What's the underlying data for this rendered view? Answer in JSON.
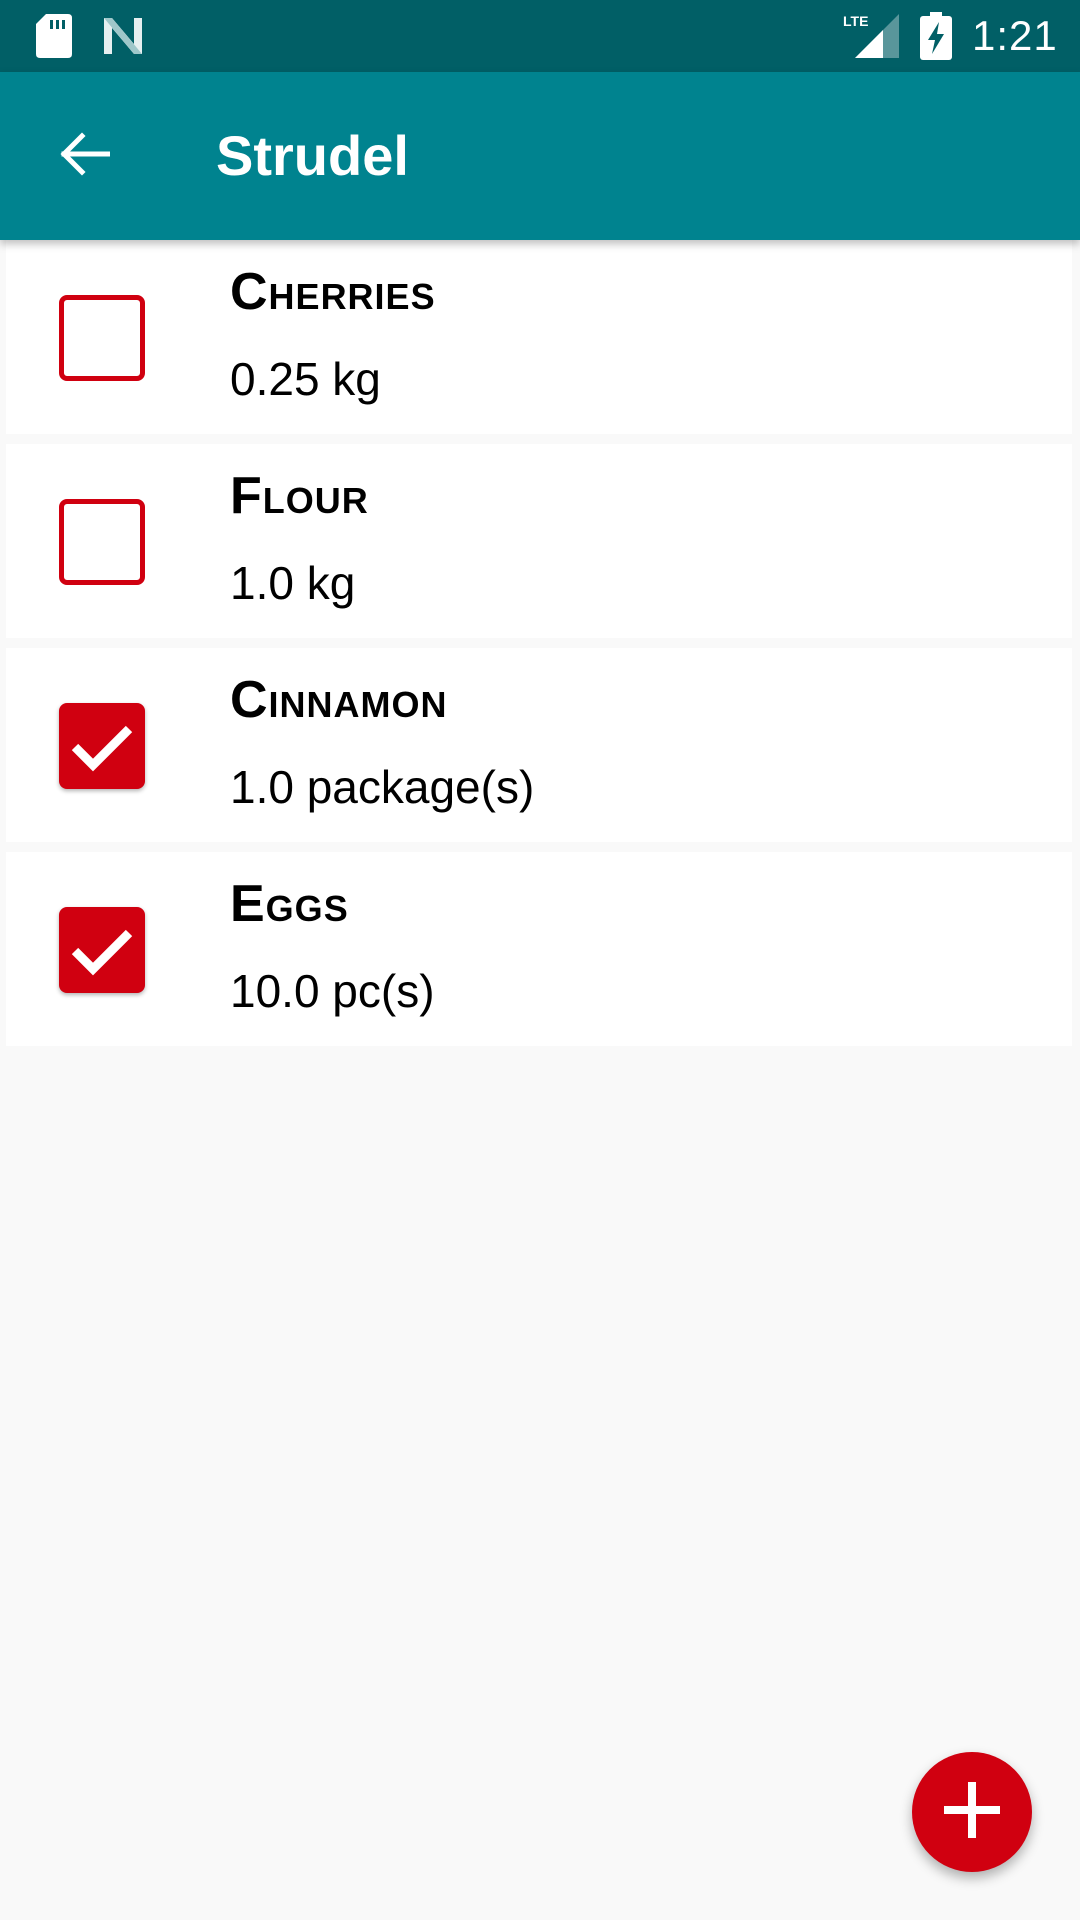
{
  "status_bar": {
    "time": "1:21",
    "network": "LTE",
    "icons": [
      "sd-card-icon",
      "n-icon",
      "lte-signal-icon",
      "battery-charging-icon"
    ]
  },
  "app_bar": {
    "back_icon": "arrow-back-icon",
    "title": "Strudel"
  },
  "items": [
    {
      "name": "Cherries",
      "quantity": "0.25 kg",
      "checked": false
    },
    {
      "name": "Flour",
      "quantity": "1.0 kg",
      "checked": false
    },
    {
      "name": "Cinnamon",
      "quantity": "1.0 package(s)",
      "checked": true
    },
    {
      "name": "Eggs",
      "quantity": "10.0 pc(s)",
      "checked": true
    }
  ],
  "fab": {
    "icon": "plus-icon"
  },
  "colors": {
    "status_bar": "#015f66",
    "app_bar": "#00838f",
    "accent": "#d00010",
    "background": "#f9f9f9"
  }
}
